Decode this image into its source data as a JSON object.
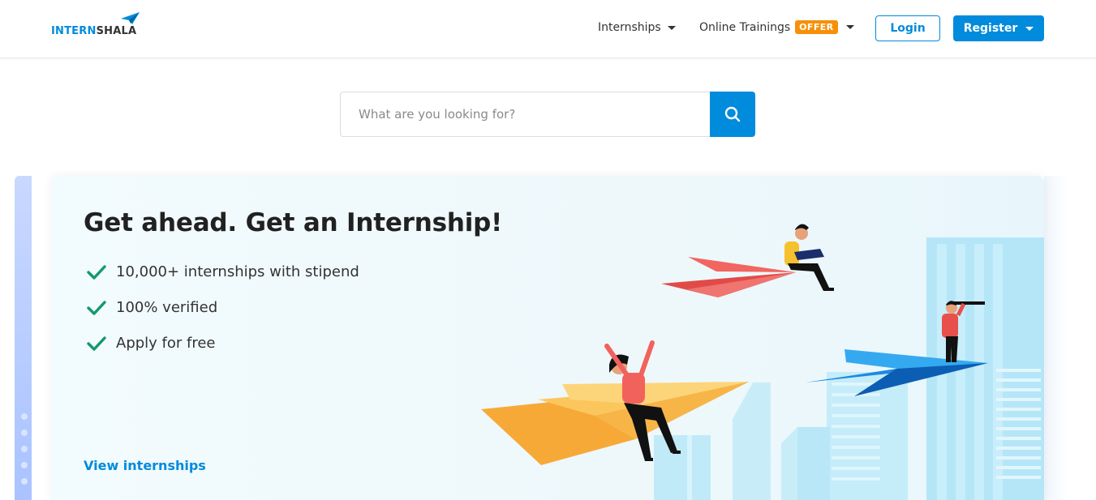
{
  "header": {
    "logo": {
      "part1": "INTERN",
      "part2": "SHALA"
    },
    "nav": {
      "internships": "Internships",
      "online_trainings": "Online Trainings",
      "offer_badge": "OFFER"
    },
    "login_label": "Login",
    "register_label": "Register"
  },
  "search": {
    "placeholder": "What are you looking for?"
  },
  "hero": {
    "title": "Get ahead. Get an Internship!",
    "bullets": [
      "10,000+ internships with stipend",
      "100% verified",
      "Apply for free"
    ],
    "link_label": "View internships"
  },
  "colors": {
    "brand": "#008bdc",
    "offer": "#f79009",
    "check": "#14996b"
  },
  "icons": {
    "search": "search-icon",
    "check": "check-icon",
    "caret": "caret-down-icon",
    "logo_plane": "paper-plane-icon"
  }
}
